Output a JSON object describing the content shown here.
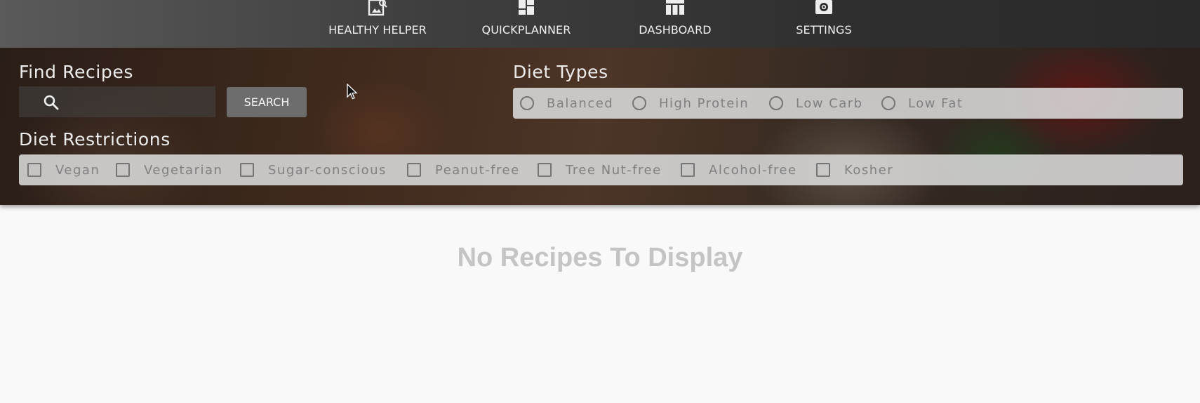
{
  "nav": {
    "items": [
      {
        "label": "HEALTHY HELPER",
        "icon": "image-search-icon"
      },
      {
        "label": "QUICKPLANNER",
        "icon": "dashboard-layout-icon"
      },
      {
        "label": "DASHBOARD",
        "icon": "calendar-view-icon"
      },
      {
        "label": "SETTINGS",
        "icon": "gear-icon"
      }
    ]
  },
  "find_recipes": {
    "title": "Find Recipes",
    "search_value": "",
    "search_button_label": "SEARCH"
  },
  "diet_types": {
    "title": "Diet Types",
    "options": [
      "Balanced",
      "High Protein",
      "Low Carb",
      "Low Fat"
    ]
  },
  "diet_restrictions": {
    "title": "Diet Restrictions",
    "options": [
      "Vegan",
      "Vegetarian",
      "Sugar-conscious",
      "Peanut-free",
      "Tree Nut-free",
      "Alcohol-free",
      "Kosher"
    ]
  },
  "main": {
    "empty_message": "No Recipes To Display"
  },
  "colors": {
    "nav_bg": "#2f2f2f",
    "option_bar_bg": "#dedede",
    "empty_text": "#c4c4c4"
  }
}
